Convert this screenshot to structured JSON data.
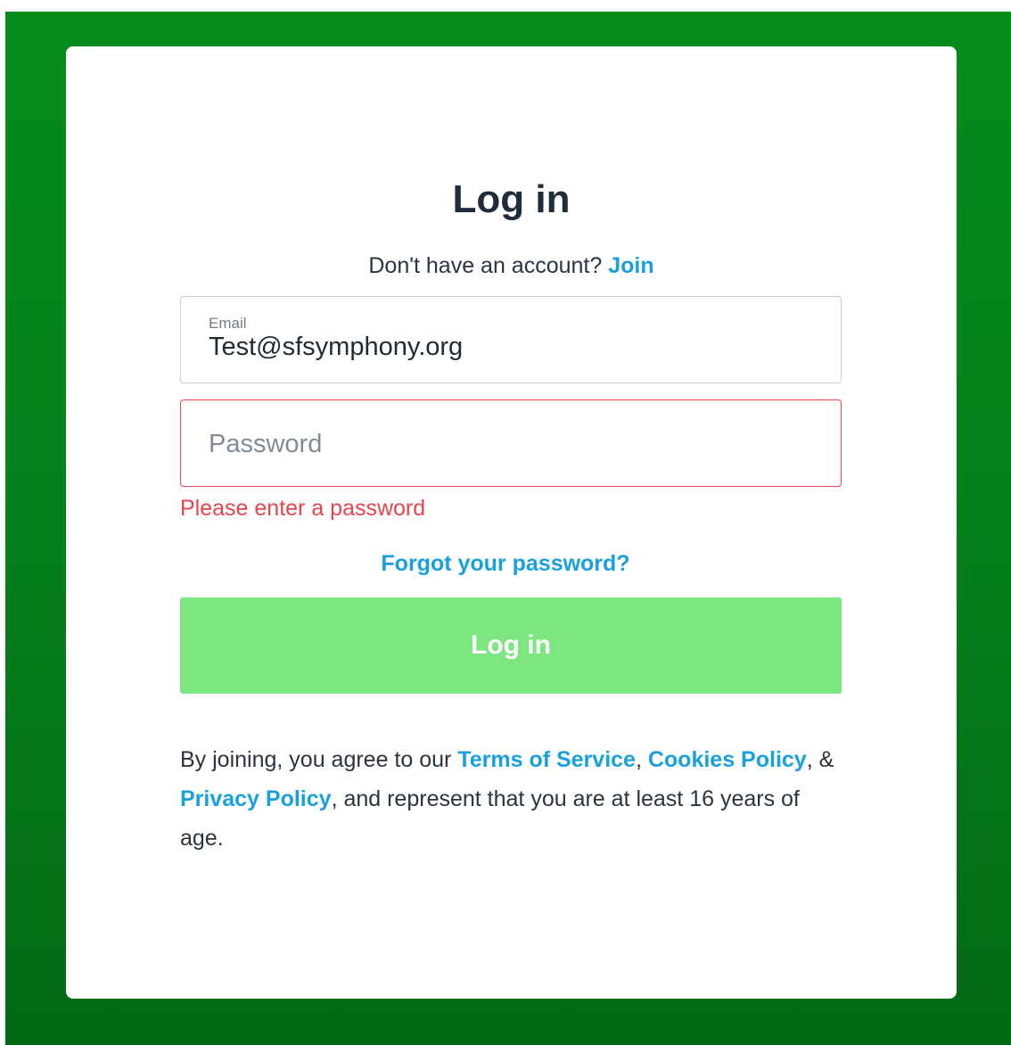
{
  "heading": {
    "title": "Log in",
    "no_account_text": "Don't have an account?",
    "join_link": "Join"
  },
  "email": {
    "label": "Email",
    "value": "Test@sfsymphony.org"
  },
  "password": {
    "placeholder": "Password",
    "error": "Please enter a password"
  },
  "forgot_link": "Forgot your password?",
  "submit_label": "Log in",
  "legal": {
    "prefix": "By joining, you agree to our ",
    "terms": "Terms of Service",
    "sep1": ", ",
    "cookies": "Cookies Policy",
    "sep2": ", & ",
    "privacy": "Privacy Policy",
    "suffix": ", and represent that you are at least 16 years of age."
  },
  "icons": {
    "annotation_arrow": "arrow-right-icon"
  },
  "colors": {
    "background": "#038c1b",
    "link": "#1aa0dc",
    "error": "#e8434f",
    "button": "#7ee681",
    "text": "#1f2d3a"
  }
}
